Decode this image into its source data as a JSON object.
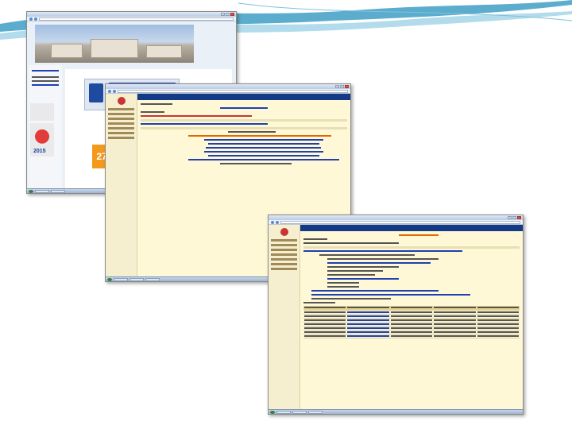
{
  "decor": {
    "accent_color": "#4aa3c8",
    "light_accent": "#9fd3e6"
  },
  "window_1": {
    "kind": "university-website-screenshot",
    "badge_number": "27",
    "year": "2015"
  },
  "window_2": {
    "kind": "library-catalog-screenshot"
  },
  "window_3": {
    "kind": "library-catalog-record-screenshot"
  }
}
